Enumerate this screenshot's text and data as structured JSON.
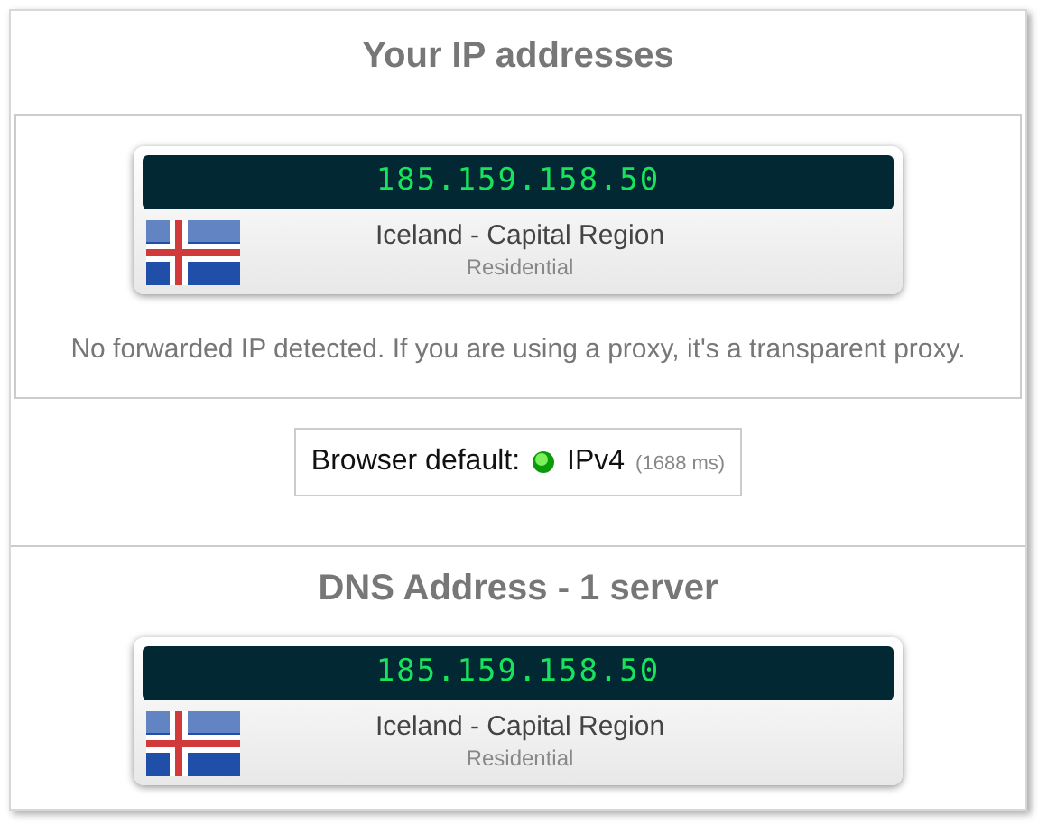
{
  "ip_section": {
    "title": "Your IP addresses",
    "cards": [
      {
        "ip": "185.159.158.50",
        "location": "Iceland - Capital Region",
        "type": "Residential"
      }
    ],
    "note": "No forwarded IP detected. If you are using a proxy, it's a transparent proxy."
  },
  "browser_default": {
    "label": "Browser default:",
    "success": true,
    "protocol": "IPv4",
    "time": "(1688 ms)"
  },
  "dns_section": {
    "title": "DNS Address - 1 server",
    "cards": [
      {
        "ip": "185.159.158.50",
        "location": "Iceland - Capital Region",
        "type": "Residential"
      }
    ]
  }
}
